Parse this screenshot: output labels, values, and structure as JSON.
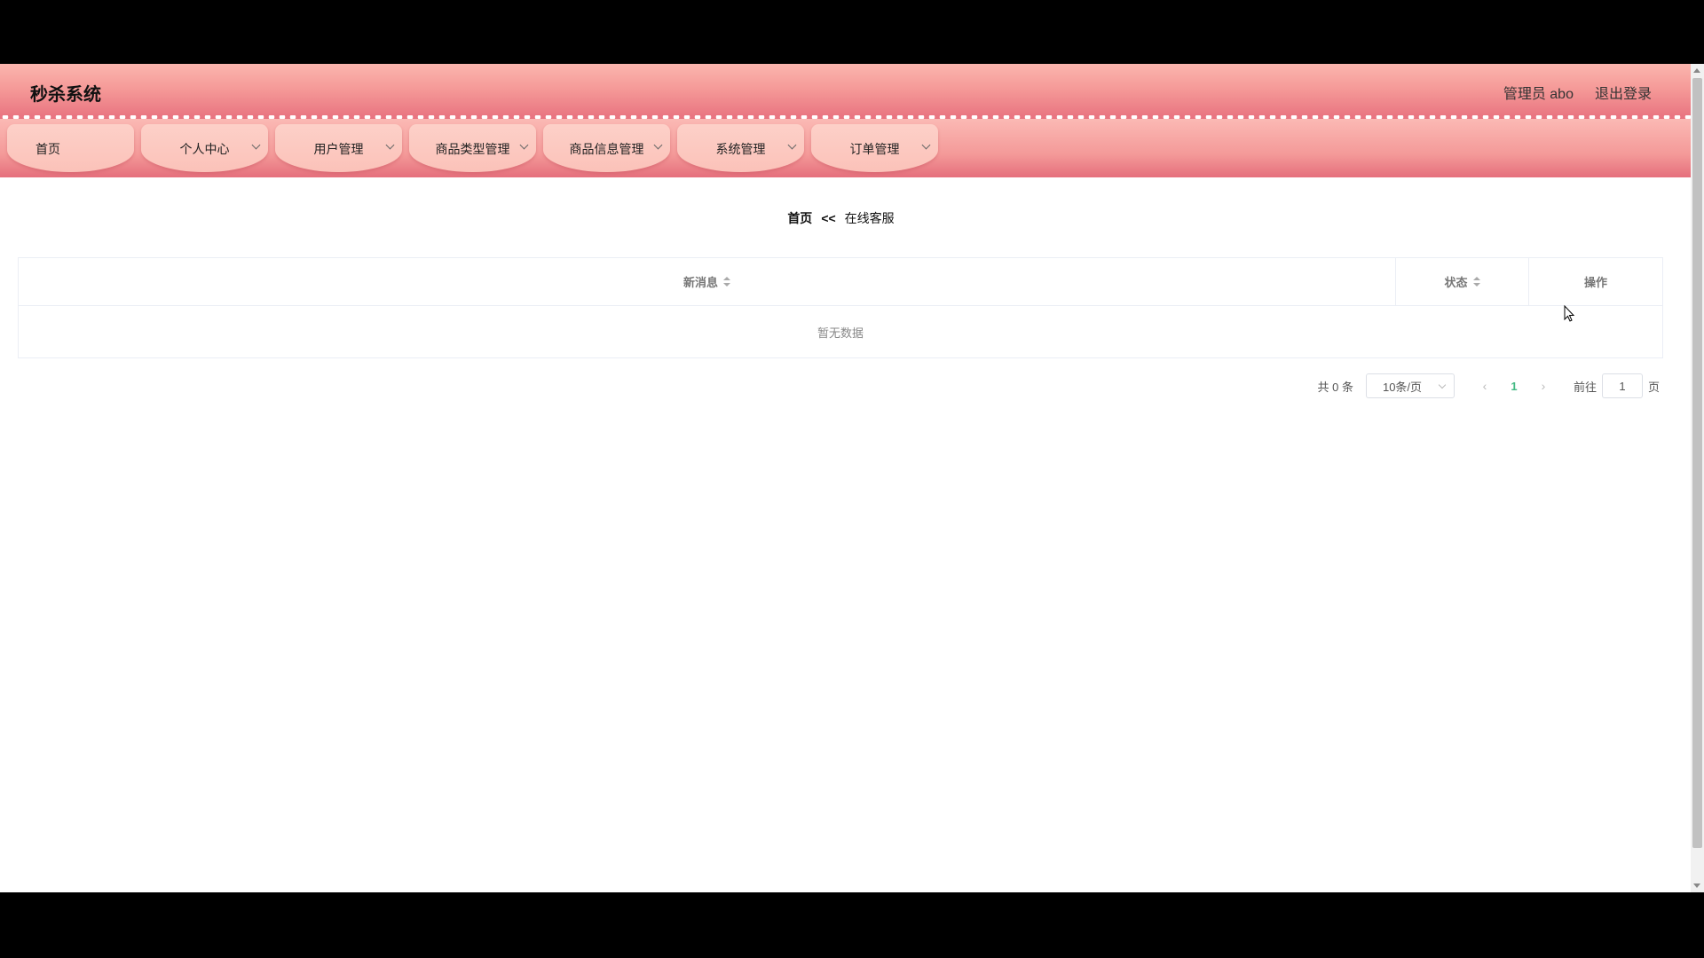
{
  "header": {
    "title": "秒杀系统",
    "user_label": "管理员 abo",
    "logout_label": "退出登录"
  },
  "nav": {
    "items": [
      {
        "label": "首页",
        "has_dropdown": false
      },
      {
        "label": "个人中心",
        "has_dropdown": true
      },
      {
        "label": "用户管理",
        "has_dropdown": true
      },
      {
        "label": "商品类型管理",
        "has_dropdown": true
      },
      {
        "label": "商品信息管理",
        "has_dropdown": true
      },
      {
        "label": "系统管理",
        "has_dropdown": true
      },
      {
        "label": "订单管理",
        "has_dropdown": true
      }
    ]
  },
  "breadcrumb": {
    "home": "首页",
    "separator": "<<",
    "current": "在线客服"
  },
  "table": {
    "columns": [
      {
        "label": "新消息",
        "sortable": true
      },
      {
        "label": "状态",
        "sortable": true
      },
      {
        "label": "操作",
        "sortable": false
      }
    ],
    "empty_text": "暂无数据"
  },
  "pagination": {
    "total_label": "共 0 条",
    "page_size": "10条/页",
    "current_page": "1",
    "goto_label": "前往",
    "goto_value": "1",
    "page_suffix": "页"
  },
  "colors": {
    "header_top": "#fbb5ae",
    "header_bottom": "#e8727f",
    "tab_bg": "#fdd0c8",
    "active_page": "#42b983"
  }
}
